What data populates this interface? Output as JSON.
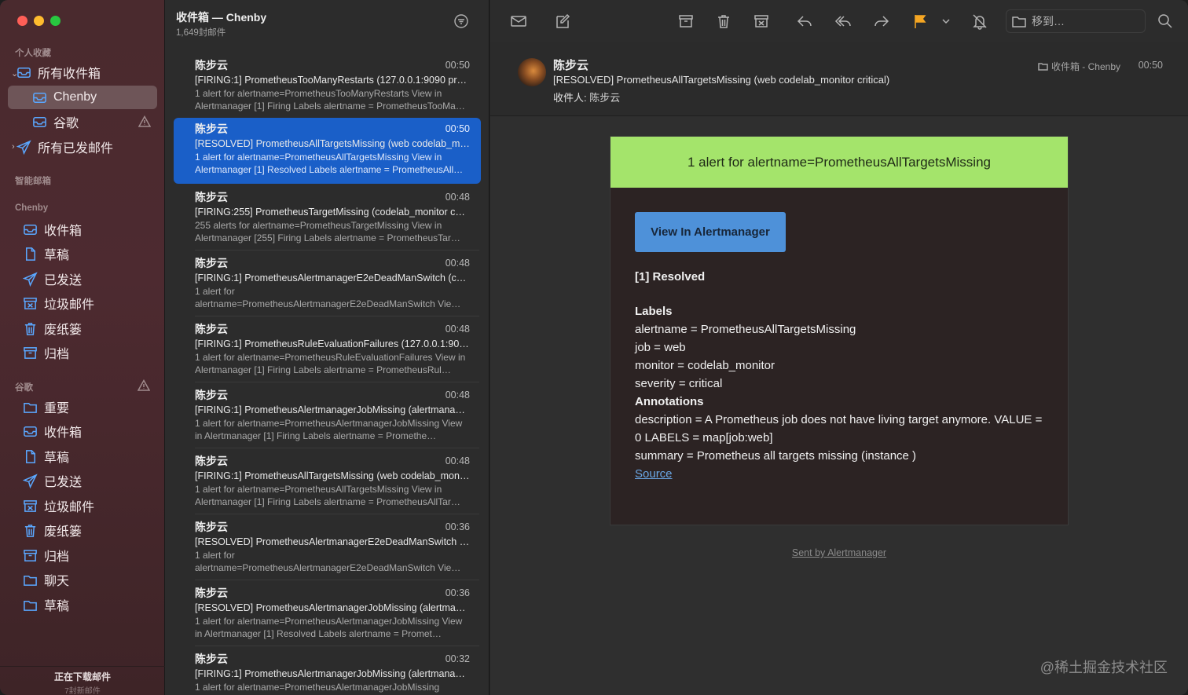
{
  "sidebar": {
    "section_favorites": "个人收藏",
    "all_inboxes": "所有收件箱",
    "chenby": "Chenby",
    "google": "谷歌",
    "all_sent": "所有已发邮件",
    "section_smart": "智能邮箱",
    "section_chenby": "Chenby",
    "chenby_items": [
      "收件箱",
      "草稿",
      "已发送",
      "垃圾邮件",
      "废纸篓",
      "归档"
    ],
    "section_google": "谷歌",
    "google_items": [
      "重要",
      "收件箱",
      "草稿",
      "已发送",
      "垃圾邮件",
      "废纸篓",
      "归档",
      "聊天",
      "草稿"
    ],
    "footer_title": "正在下载邮件",
    "footer_sub": "7封新邮件"
  },
  "list": {
    "title": "收件箱 — Chenby",
    "count": "1,649封邮件",
    "messages": [
      {
        "from": "陈步云",
        "time": "00:50",
        "subject": "[FIRING:1] PrometheusTooManyRestarts (127.0.0.1:9090 pro…",
        "preview": "1 alert for alertname=PrometheusTooManyRestarts View in Alertmanager [1] Firing Labels alertname = PrometheusTooMa…"
      },
      {
        "from": "陈步云",
        "time": "00:50",
        "subject": "[RESOLVED] PrometheusAllTargetsMissing (web codelab_m…",
        "preview": "1 alert for alertname=PrometheusAllTargetsMissing View in Alertmanager [1] Resolved Labels alertname = PrometheusAll…"
      },
      {
        "from": "陈步云",
        "time": "00:48",
        "subject": "[FIRING:255] PrometheusTargetMissing (codelab_monitor c…",
        "preview": "255 alerts for alertname=PrometheusTargetMissing View in Alertmanager [255] Firing Labels alertname = PrometheusTar…"
      },
      {
        "from": "陈步云",
        "time": "00:48",
        "subject": "[FIRING:1] PrometheusAlertmanagerE2eDeadManSwitch (co…",
        "preview": "1 alert for alertname=PrometheusAlertmanagerE2eDeadManSwitch Vie…"
      },
      {
        "from": "陈步云",
        "time": "00:48",
        "subject": "[FIRING:1] PrometheusRuleEvaluationFailures (127.0.0.1:909…",
        "preview": "1 alert for alertname=PrometheusRuleEvaluationFailures View in Alertmanager [1] Firing Labels alertname = PrometheusRul…"
      },
      {
        "from": "陈步云",
        "time": "00:48",
        "subject": "[FIRING:1] PrometheusAlertmanagerJobMissing (alertmanag…",
        "preview": "1 alert for alertname=PrometheusAlertmanagerJobMissing View in Alertmanager [1] Firing Labels alertname = Promethe…"
      },
      {
        "from": "陈步云",
        "time": "00:48",
        "subject": "[FIRING:1] PrometheusAllTargetsMissing (web codelab_mon…",
        "preview": "1 alert for alertname=PrometheusAllTargetsMissing View in Alertmanager [1] Firing Labels alertname = PrometheusAllTar…"
      },
      {
        "from": "陈步云",
        "time": "00:36",
        "subject": "[RESOLVED] PrometheusAlertmanagerE2eDeadManSwitch (…",
        "preview": "1 alert for alertname=PrometheusAlertmanagerE2eDeadManSwitch Vie…"
      },
      {
        "from": "陈步云",
        "time": "00:36",
        "subject": "[RESOLVED] PrometheusAlertmanagerJobMissing (alertman…",
        "preview": "1 alert for alertname=PrometheusAlertmanagerJobMissing View in Alertmanager [1] Resolved Labels alertname = Promet…"
      },
      {
        "from": "陈步云",
        "time": "00:32",
        "subject": "[FIRING:1] PrometheusAlertmanagerJobMissing (alertmanag…",
        "preview": "1 alert for alertname=PrometheusAlertmanagerJobMissing"
      }
    ]
  },
  "toolbar": {
    "move_to": "移到…"
  },
  "mail": {
    "from": "陈步云",
    "subject": "[RESOLVED] PrometheusAllTargetsMissing (web codelab_monitor critical)",
    "to_label": "收件人:",
    "to": "陈步云",
    "mailbox": "收件箱 - Chenby",
    "time": "00:50",
    "header_banner": "1 alert for alertname=PrometheusAllTargetsMissing",
    "button": "View In Alertmanager",
    "resolved": "[1] Resolved",
    "labels_title": "Labels",
    "labels": [
      "alertname = PrometheusAllTargetsMissing",
      "job = web",
      "monitor = codelab_monitor",
      "severity = critical"
    ],
    "annotations_title": "Annotations",
    "annotation_lines": [
      "description = A Prometheus job does not have living target anymore. VALUE =",
      "0 LABELS = map[job:web]",
      "summary = Prometheus all targets missing (instance )"
    ],
    "source_link": "Source",
    "sent_by": "Sent by Alertmanager"
  },
  "watermark": "@稀土掘金技术社区",
  "colors": {
    "accent": "#5aa7ff",
    "selected_row": "#1a5fc8",
    "banner": "#a4e46b",
    "button": "#4e91d9",
    "flag": "#f5a623"
  }
}
